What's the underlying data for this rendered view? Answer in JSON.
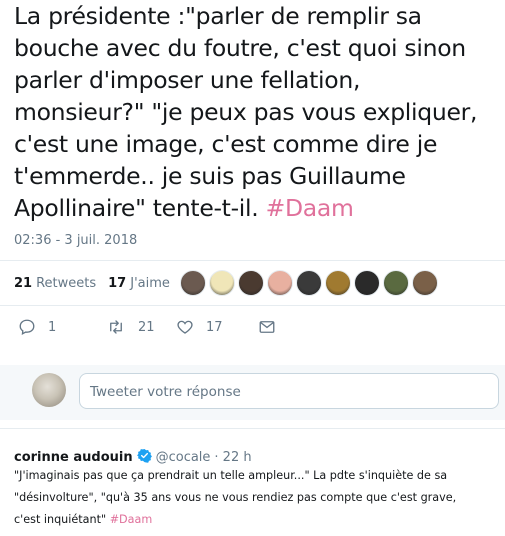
{
  "tweet": {
    "text_lines": [
      "La présidente :\"parler de remplir sa",
      "bouche avec du foutre, c'est quoi sinon",
      "parler d'imposer une fellation,",
      "monsieur?\" \"je peux pas vous expliquer,",
      "c'est une image, c'est comme dire je",
      "t'emmerde.. je suis pas Guillaume",
      "Apollinaire\" tente-t-il. "
    ],
    "hashtag": "#Daam",
    "timestamp": "02:36 - 3 juil. 2018",
    "retweets_count": "21",
    "retweets_label": "Retweets",
    "likes_count": "17",
    "likes_label": "J'aime",
    "avatar_colors": [
      "#6b5a50",
      "#f0e6b8",
      "#4a3a30",
      "#e8b0a0",
      "#3a3a3a",
      "#a07a30",
      "#2a2a2a",
      "#5a6a40",
      "#7a6048"
    ]
  },
  "actions": {
    "reply_count": "1",
    "retweet_count": "21",
    "like_count": "17"
  },
  "reply_box": {
    "placeholder": "Tweeter votre réponse"
  },
  "reply": {
    "name": "corinne audouin",
    "handle": "@cocale",
    "time": "· 22 h",
    "text_lines": [
      "\"J'imaginais pas que ça prendrait un telle ampleur...\" La pdte s'inquiète de sa",
      "\"désinvolture\", \"qu'à 35 ans vous ne vous rendiez pas compte que c'est grave,",
      "c'est inquiétant\" "
    ],
    "hashtag": "#Daam"
  },
  "colors": {
    "hashtag": "#e0719b",
    "text": "#14171a",
    "secondary": "#657786",
    "verified": "#1da1f2"
  }
}
